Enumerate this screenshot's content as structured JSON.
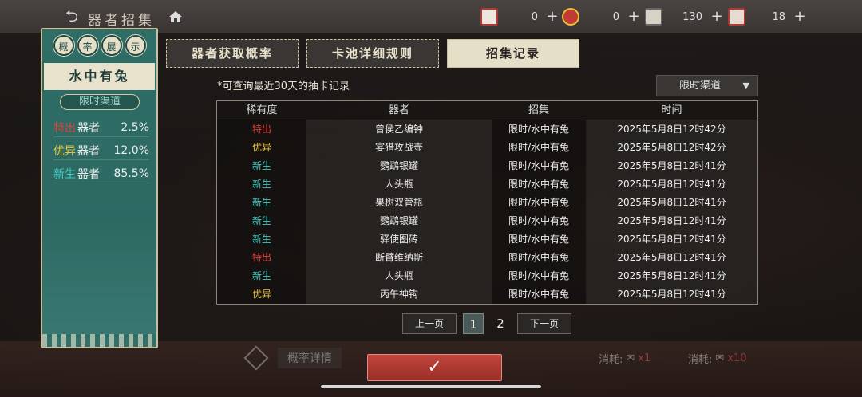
{
  "topbar": {
    "title": "器者招集",
    "resources": [
      {
        "icon": "red-envelope-icon",
        "value": "0"
      },
      {
        "icon": "ticket-icon",
        "value": "0"
      },
      {
        "icon": "scroll-icon",
        "value": "130"
      },
      {
        "icon": "seal-icon",
        "value": "18"
      }
    ]
  },
  "rate_panel": {
    "header_chars": [
      "概",
      "率",
      "展",
      "示"
    ],
    "pool_name": "水中有兔",
    "channel": "限时渠道",
    "rows": [
      {
        "tier": "特出",
        "tier_color": "#e2403a",
        "label": "器者",
        "percent": "2.5%"
      },
      {
        "tier": "优异",
        "tier_color": "#e7c23a",
        "label": "器者",
        "percent": "12.0%"
      },
      {
        "tier": "新生",
        "tier_color": "#3ec9c0",
        "label": "器者",
        "percent": "85.5%"
      }
    ]
  },
  "tabs": [
    {
      "label": "器者获取概率",
      "active": false
    },
    {
      "label": "卡池详细规则",
      "active": false
    },
    {
      "label": "招集记录",
      "active": true
    }
  ],
  "hint": "*可查询最近30天的抽卡记录",
  "channel_select": {
    "value": "限时渠道"
  },
  "table": {
    "headers": [
      "稀有度",
      "器者",
      "招集",
      "时间"
    ],
    "rows": [
      {
        "rarity": "特出",
        "color": "#e2403a",
        "name": "曾侯乙编钟",
        "pool": "限时/水中有兔",
        "time": "2025年5月8日12时42分"
      },
      {
        "rarity": "优异",
        "color": "#e7c23a",
        "name": "宴猎攻战壶",
        "pool": "限时/水中有兔",
        "time": "2025年5月8日12时42分"
      },
      {
        "rarity": "新生",
        "color": "#3ec9c0",
        "name": "鹦鹉银罐",
        "pool": "限时/水中有兔",
        "time": "2025年5月8日12时41分"
      },
      {
        "rarity": "新生",
        "color": "#3ec9c0",
        "name": "人头瓶",
        "pool": "限时/水中有兔",
        "time": "2025年5月8日12时41分"
      },
      {
        "rarity": "新生",
        "color": "#3ec9c0",
        "name": "果树双管瓶",
        "pool": "限时/水中有兔",
        "time": "2025年5月8日12时41分"
      },
      {
        "rarity": "新生",
        "color": "#3ec9c0",
        "name": "鹦鹉银罐",
        "pool": "限时/水中有兔",
        "time": "2025年5月8日12时41分"
      },
      {
        "rarity": "新生",
        "color": "#3ec9c0",
        "name": "驿使图砖",
        "pool": "限时/水中有兔",
        "time": "2025年5月8日12时41分"
      },
      {
        "rarity": "特出",
        "color": "#e2403a",
        "name": "断臂维纳斯",
        "pool": "限时/水中有兔",
        "time": "2025年5月8日12时41分"
      },
      {
        "rarity": "新生",
        "color": "#3ec9c0",
        "name": "人头瓶",
        "pool": "限时/水中有兔",
        "time": "2025年5月8日12时41分"
      },
      {
        "rarity": "优异",
        "color": "#e7c23a",
        "name": "丙午神钩",
        "pool": "限时/水中有兔",
        "time": "2025年5月8日12时41分"
      }
    ]
  },
  "pager": {
    "prev": "上一页",
    "pages": [
      "1",
      "2"
    ],
    "current": "1",
    "next": "下一页"
  },
  "bottom": {
    "rate_detail": "概率详情",
    "cost_label": "消耗:",
    "cost_single": "x1",
    "cost_ten": "x10"
  }
}
